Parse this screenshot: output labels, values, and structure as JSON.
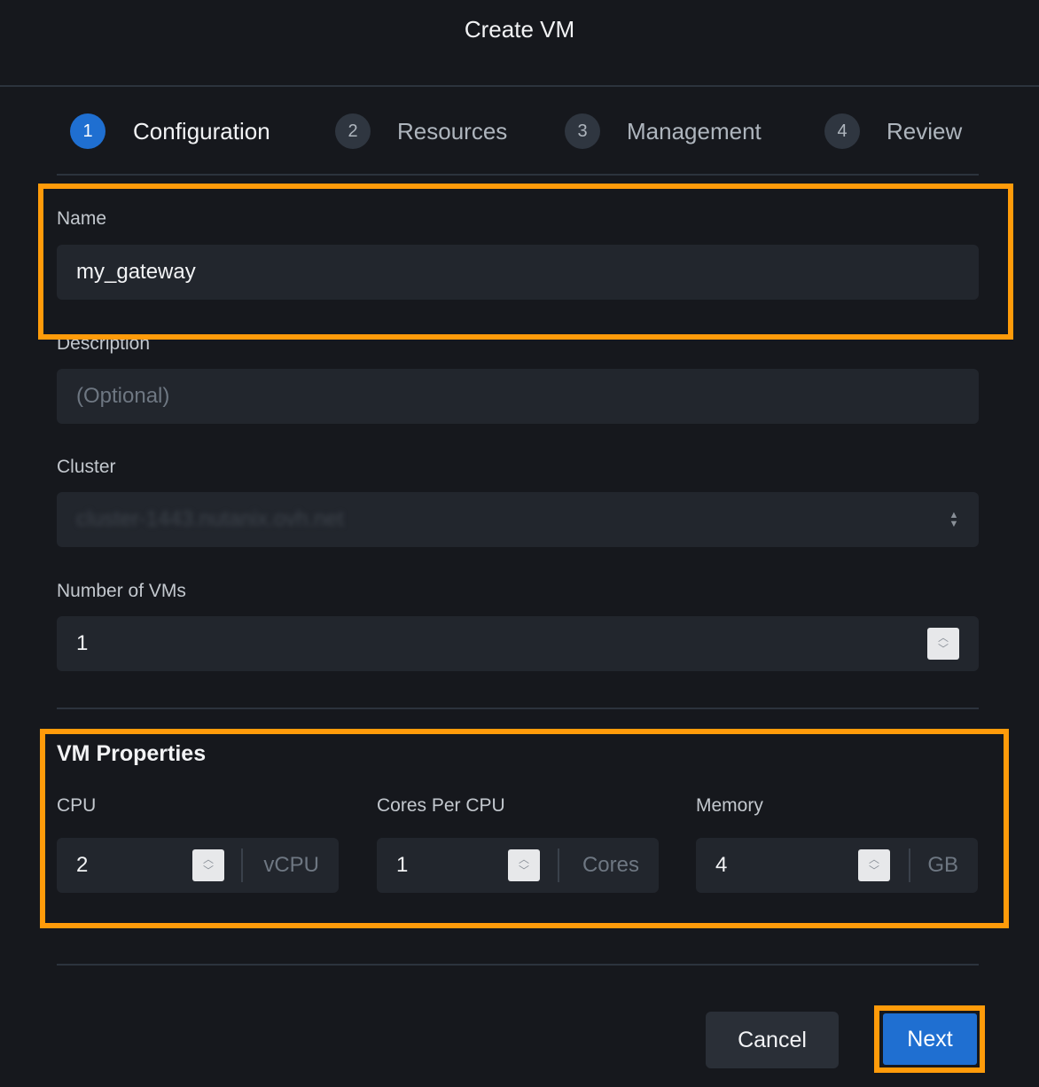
{
  "dialog": {
    "title": "Create VM"
  },
  "steps": [
    {
      "number": "1",
      "label": "Configuration"
    },
    {
      "number": "2",
      "label": "Resources"
    },
    {
      "number": "3",
      "label": "Management"
    },
    {
      "number": "4",
      "label": "Review"
    }
  ],
  "form": {
    "name": {
      "label": "Name",
      "value": "my_gateway"
    },
    "description": {
      "label": "Description",
      "placeholder": "(Optional)"
    },
    "cluster": {
      "label": "Cluster",
      "value": "cluster-1443.nutanix.ovh.net"
    },
    "num_vms": {
      "label": "Number of VMs",
      "value": "1"
    }
  },
  "vm_properties": {
    "heading": "VM Properties",
    "cpu": {
      "label": "CPU",
      "value": "2",
      "unit": "vCPU"
    },
    "cores": {
      "label": "Cores Per CPU",
      "value": "1",
      "unit": "Cores"
    },
    "memory": {
      "label": "Memory",
      "value": "4",
      "unit": "GB"
    }
  },
  "footer": {
    "cancel_label": "Cancel",
    "next_label": "Next"
  },
  "colors": {
    "accent": "#1f6fd1",
    "highlight": "#ff9b0a",
    "background": "#16181d"
  }
}
